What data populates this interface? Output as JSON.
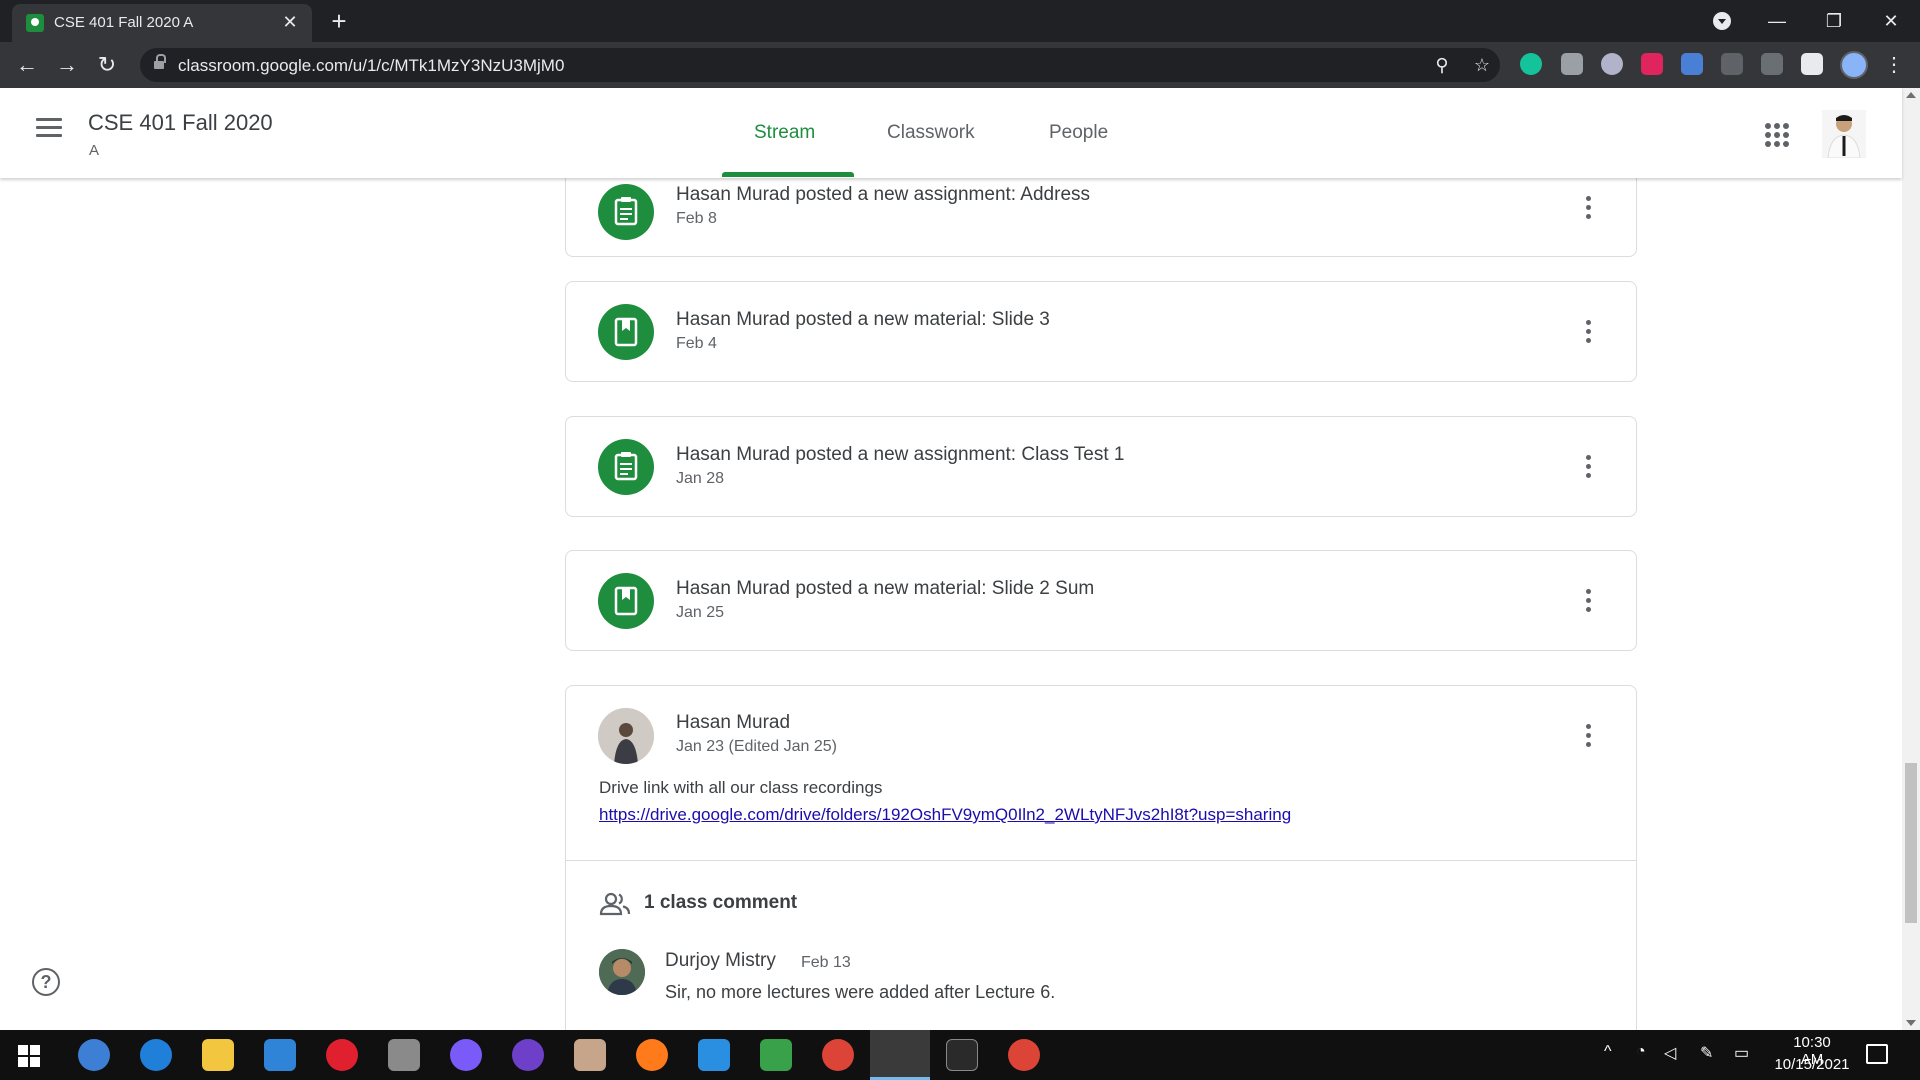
{
  "browser": {
    "tab_title": "CSE 401 Fall 2020 A",
    "tab_close": "✕",
    "new_tab": "+",
    "url": "classroom.google.com/u/1/c/MTk1MzY3NzU3MjM0",
    "window_minimize": "—",
    "window_restore": "❐",
    "window_close": "✕"
  },
  "classroom": {
    "class_name": "CSE 401 Fall 2020",
    "section": "A",
    "tabs": [
      {
        "label": "Stream",
        "active": true
      },
      {
        "label": "Classwork",
        "active": false
      },
      {
        "label": "People",
        "active": false
      }
    ]
  },
  "stream": {
    "posts": [
      {
        "kind": "assignment",
        "icon": "assignment-icon",
        "title": "Hasan Murad posted a new assignment: Address",
        "date": "Feb 8"
      },
      {
        "kind": "material",
        "icon": "material-icon",
        "title": "Hasan Murad posted a new material: Slide 3",
        "date": "Feb 4"
      },
      {
        "kind": "assignment",
        "icon": "assignment-icon",
        "title": "Hasan Murad posted a new assignment: Class Test 1",
        "date": "Jan 28"
      },
      {
        "kind": "material",
        "icon": "material-icon",
        "title": "Hasan Murad posted a new material: Slide 2 Sum",
        "date": "Jan 25"
      }
    ],
    "announcement": {
      "author": "Hasan Murad",
      "date": "Jan 23 (Edited Jan 25)",
      "text": "Drive link with all our class recordings",
      "link": "https://drive.google.com/drive/folders/192OshFV9ymQ0Iln2_2WLtyNFJvs2hI8t?usp=sharing",
      "comment_count": "1 class comment",
      "comment": {
        "author": "Durjoy Mistry",
        "date": "Feb 13",
        "text": "Sir, no more lectures were added after Lecture 6."
      }
    }
  },
  "help_label": "?",
  "taskbar": {
    "time": "10:30 AM",
    "date": "10/15/2021"
  },
  "colors": {
    "accent_green": "#1e8e3e",
    "chrome_dark": "#202124",
    "link_blue": "#1a0dab"
  }
}
